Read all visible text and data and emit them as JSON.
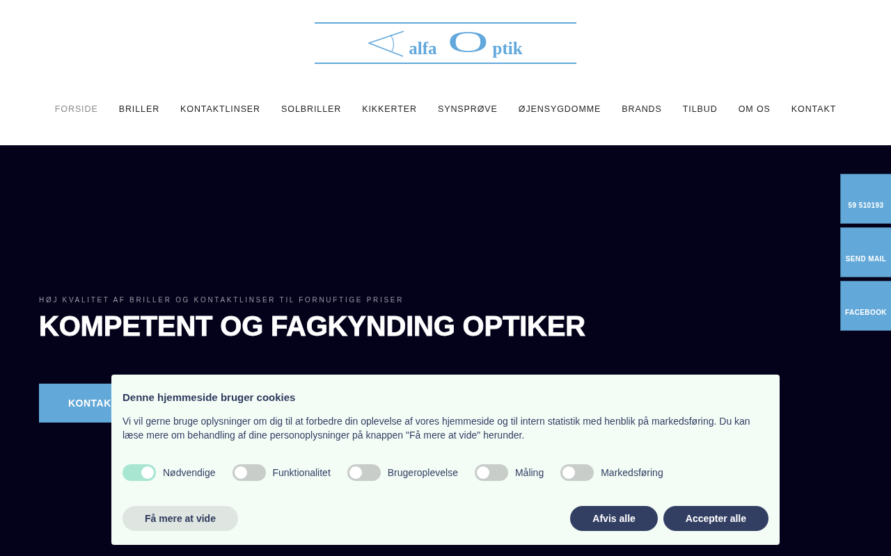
{
  "logo": {
    "parts": [
      {
        "kind": "word",
        "text": "alfa"
      },
      {
        "kind": "initial",
        "text": "O"
      },
      {
        "kind": "word",
        "text": "ptik"
      }
    ]
  },
  "nav": {
    "items": [
      {
        "label": "FORSIDE",
        "selected": true
      },
      {
        "label": "BRILLER",
        "selected": false
      },
      {
        "label": "KONTAKTLINSER",
        "selected": false
      },
      {
        "label": "SOLBRILLER",
        "selected": false
      },
      {
        "label": "KIKKERTER",
        "selected": false
      },
      {
        "label": "SYNSPRØVE",
        "selected": false
      },
      {
        "label": "ØJENSYGDOMME",
        "selected": false
      },
      {
        "label": "BRANDS",
        "selected": false
      },
      {
        "label": "TILBUD",
        "selected": false
      },
      {
        "label": "OM OS",
        "selected": false
      },
      {
        "label": "KONTAKT",
        "selected": false
      }
    ]
  },
  "hero": {
    "eyebrow": "HØJ KVALITET AF BRILLER OG KONTAKTLINSER TIL FORNUFTIGE PRISER",
    "headline": "KOMPETENT OG FAGKYNDING OPTIKER",
    "button": "KONTAK"
  },
  "side_buttons": [
    "59 510193",
    "SEND MAIL",
    "FACEBOOK"
  ],
  "cookie_banner": {
    "title": "Denne hjemmeside bruger cookies",
    "text": "Vi vil gerne bruge oplysninger om dig til at forbedre din oplevelse af vores hjemmeside og til intern statistik med henblik på markedsføring. Du kan læse mere om behandling af dine personoplysninger på knappen \"Få mere at vide\" herunder.",
    "toggles": [
      {
        "label": "Nødvendige",
        "on": true
      },
      {
        "label": "Funktionalitet",
        "on": false
      },
      {
        "label": "Brugeroplevelse",
        "on": false
      },
      {
        "label": "Måling",
        "on": false
      },
      {
        "label": "Markedsføring",
        "on": false
      }
    ],
    "buttons": [
      {
        "label": "Få mere at vide",
        "kind": "secondary"
      },
      {
        "label": "Afvis alle",
        "kind": "primary"
      },
      {
        "label": "Accepter alle",
        "kind": "primary"
      }
    ]
  }
}
